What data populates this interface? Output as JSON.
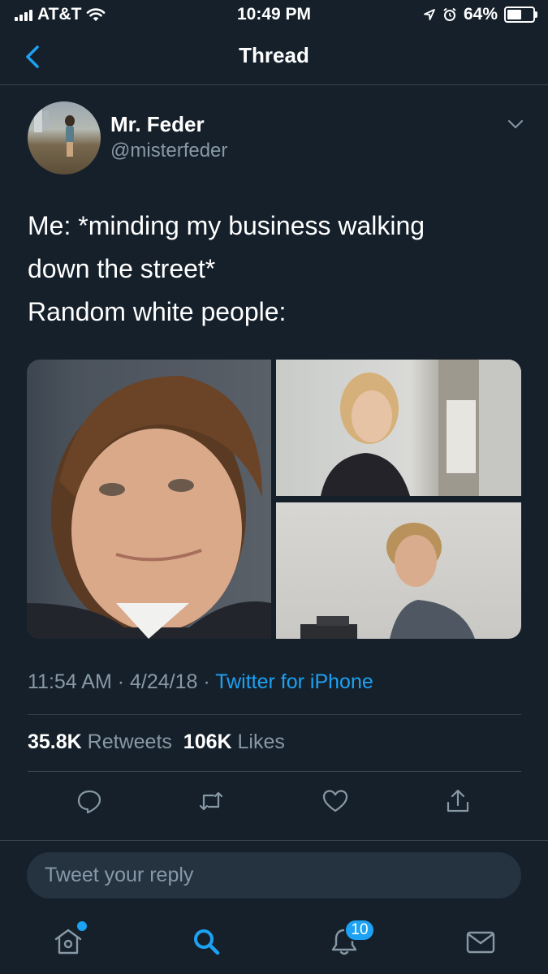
{
  "status_bar": {
    "carrier": "AT&T",
    "time": "10:49 PM",
    "battery": "64%",
    "battery_level": 0.64
  },
  "nav": {
    "title": "Thread"
  },
  "tweet": {
    "author_name": "Mr. Feder",
    "author_handle": "@misterfeder",
    "text_lines": [
      "Me: *minding my business walking",
      "down the street*",
      "Random white people:"
    ],
    "time": "11:54 AM",
    "date": "4/24/18",
    "separator": "·",
    "source": "Twitter for iPhone",
    "retweets_count": "35.8K",
    "retweets_label": "Retweets",
    "likes_count": "106K",
    "likes_label": "Likes"
  },
  "actions": [
    "reply-icon",
    "retweet-icon",
    "like-icon",
    "share-icon"
  ],
  "reply": {
    "placeholder": "Tweet your reply"
  },
  "tab_bar": {
    "items": [
      "home-icon",
      "search-icon",
      "notifications-icon",
      "messages-icon"
    ],
    "notifications_badge": "10"
  },
  "colors": {
    "background": "#15202b",
    "accent": "#1da1f2",
    "muted": "#8899a6",
    "divider": "#38444d"
  }
}
